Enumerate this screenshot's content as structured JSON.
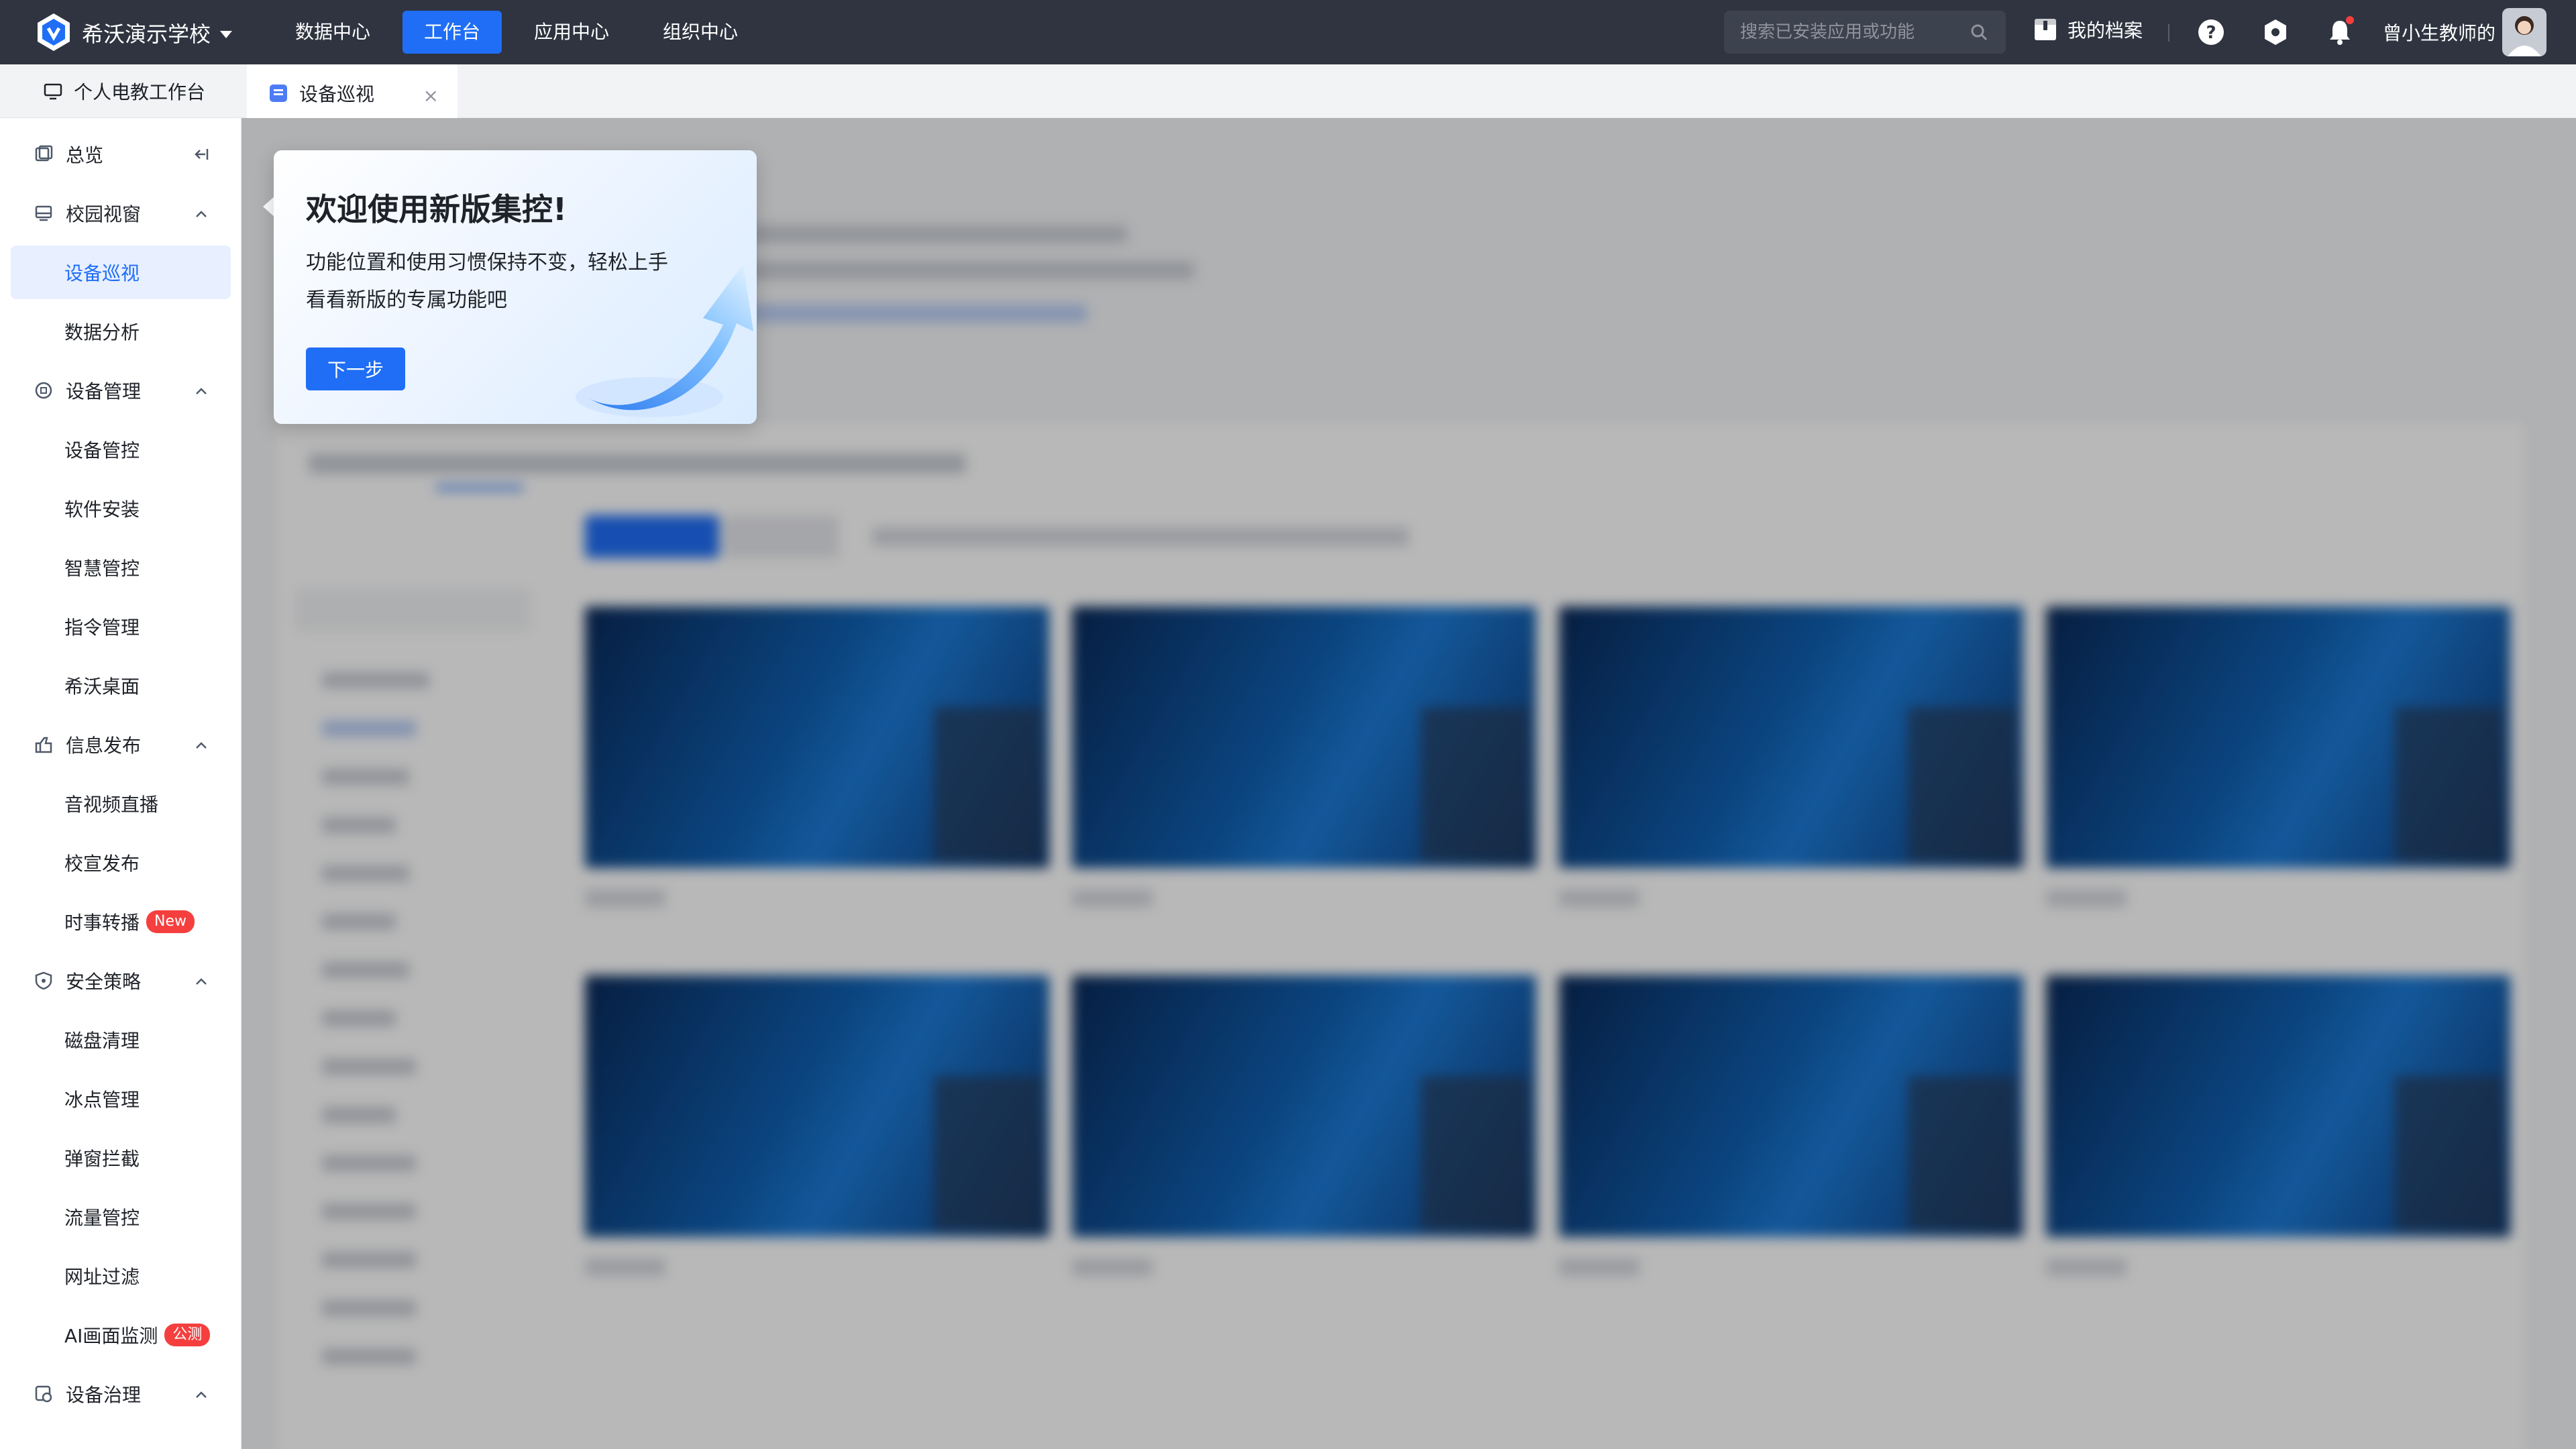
{
  "topbar": {
    "school_name": "希沃演示学校",
    "nav": [
      "数据中心",
      "工作台",
      "应用中心",
      "组织中心"
    ],
    "active_nav_index": 1,
    "search_placeholder": "搜索已安装应用或功能",
    "my_profile": "我的档案",
    "user_name": "曾小生教师的"
  },
  "tabs": {
    "workbench": "个人电教工作台",
    "active_tab": "设备巡视",
    "close": "×"
  },
  "sidebar": {
    "overview": "总览",
    "groups": [
      {
        "label": "校园视窗",
        "items": [
          "设备巡视",
          "数据分析"
        ]
      },
      {
        "label": "设备管理",
        "items": [
          "设备管控",
          "软件安装",
          "智慧管控",
          "指令管理",
          "希沃桌面"
        ]
      },
      {
        "label": "信息发布",
        "items": [
          "音视频直播",
          "校宣发布",
          "时事转播"
        ]
      },
      {
        "label": "安全策略",
        "items": [
          "磁盘清理",
          "冰点管理",
          "弹窗拦截",
          "流量管控",
          "网址过滤",
          "AI画面监测"
        ]
      },
      {
        "label": "设备治理",
        "items": []
      }
    ],
    "badge_new": "New",
    "badge_beta": "公测"
  },
  "popover": {
    "title": "欢迎使用新版集控!",
    "line1": "功能位置和使用习惯保持不变，轻松上手",
    "line2": "看看新版的专属功能吧",
    "next_button": "下一步"
  },
  "colors": {
    "accent": "#1f6ef5",
    "topbar_bg": "#2f3440",
    "badge_red": "#f53f3f"
  }
}
